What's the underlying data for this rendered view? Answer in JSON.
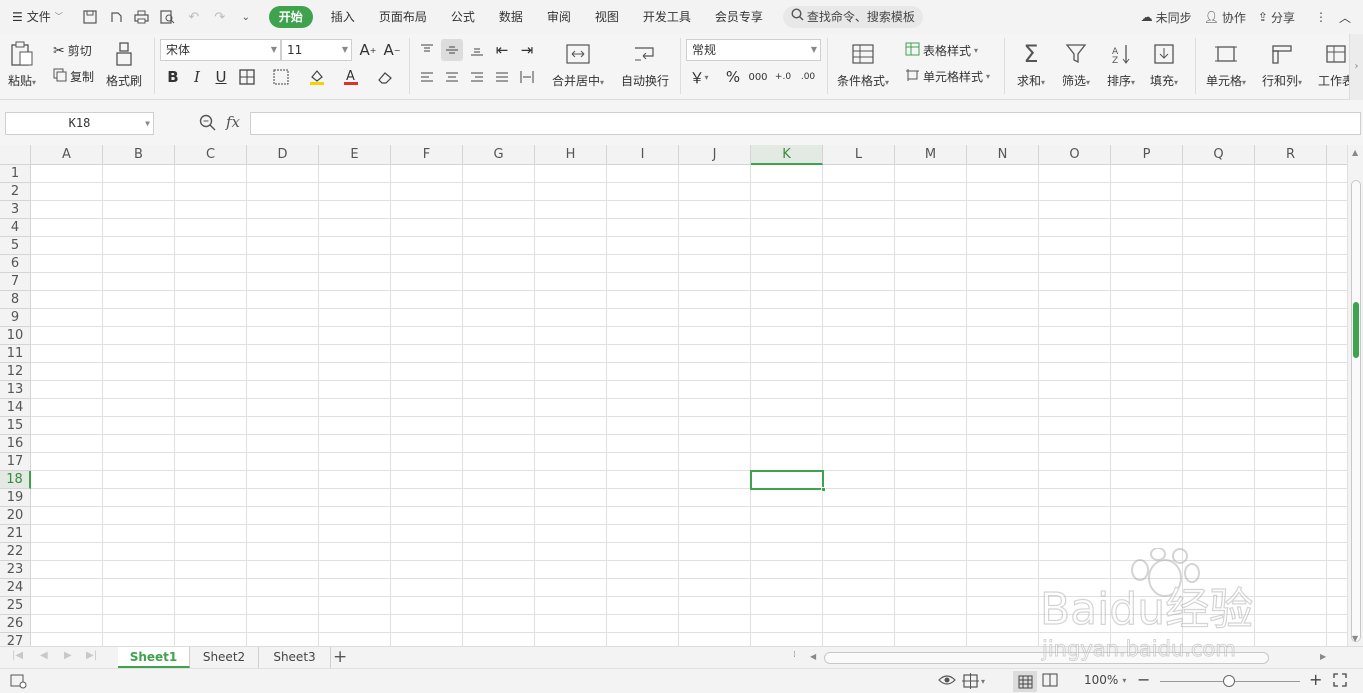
{
  "menubar": {
    "file": "文件",
    "tabs": [
      {
        "label": "开始",
        "active": true
      },
      {
        "label": "插入"
      },
      {
        "label": "页面布局"
      },
      {
        "label": "公式"
      },
      {
        "label": "数据"
      },
      {
        "label": "审阅"
      },
      {
        "label": "视图"
      },
      {
        "label": "开发工具"
      },
      {
        "label": "会员专享"
      }
    ],
    "search": "查找命令、搜索模板",
    "sync": "未同步",
    "collab": "协作",
    "share": "分享"
  },
  "ribbon": {
    "paste": "粘贴",
    "cut": "剪切",
    "copy": "复制",
    "format_painter": "格式刷",
    "font_name": "宋体",
    "font_size": "11",
    "merge": "合并居中",
    "wrap": "自动换行",
    "number_format": "常规",
    "currency": "￥",
    "percent": "%",
    "cond_format": "条件格式",
    "table_style": "表格样式",
    "cell_style": "单元格样式",
    "sum": "求和",
    "filter": "筛选",
    "sort": "排序",
    "fill": "填充",
    "cell": "单元格",
    "row_col": "行和列",
    "worksheet": "工作表"
  },
  "formula_bar": {
    "name_box": "K18",
    "fx": "fx",
    "formula": ""
  },
  "grid": {
    "columns": [
      "A",
      "B",
      "C",
      "D",
      "E",
      "F",
      "G",
      "H",
      "I",
      "J",
      "K",
      "L",
      "M",
      "N",
      "O",
      "P",
      "Q",
      "R"
    ],
    "selected_column": "K",
    "rows": [
      "1",
      "2",
      "3",
      "4",
      "5",
      "6",
      "7",
      "8",
      "9",
      "10",
      "11",
      "12",
      "13",
      "14",
      "15",
      "16",
      "17",
      "18",
      "19",
      "20",
      "21",
      "22",
      "23",
      "24",
      "25",
      "26",
      "27"
    ],
    "selected_row": "18"
  },
  "sheets": [
    {
      "label": "Sheet1",
      "active": true
    },
    {
      "label": "Sheet2"
    },
    {
      "label": "Sheet3"
    }
  ],
  "statusbar": {
    "zoom": "100%"
  },
  "watermark": {
    "brand": "Baidu经验",
    "url": "jingyan.baidu.com"
  },
  "colors": {
    "accent": "#3fa34d",
    "font_color_bar": "#e03030",
    "fill_color_bar": "#f5d300"
  }
}
